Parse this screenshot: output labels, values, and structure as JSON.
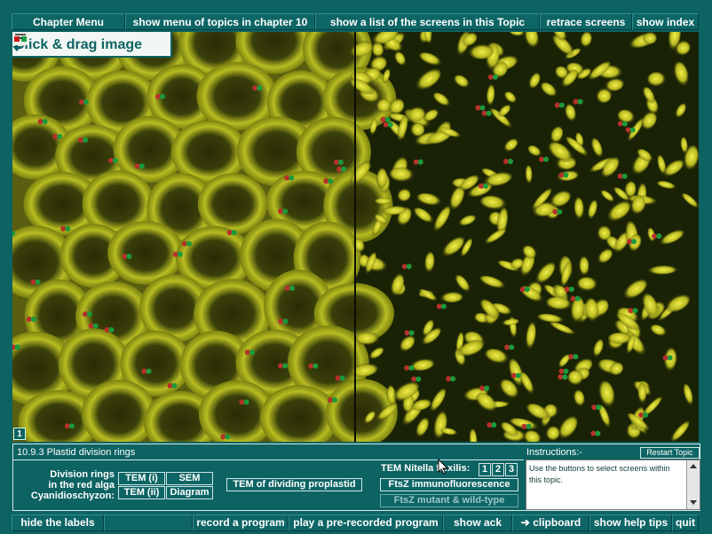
{
  "top_menu": {
    "chapter_menu": "Chapter Menu",
    "topics_menu": "show  menu of topics in  chapter  10",
    "screens_list": "show  a list of the screens in this Topic",
    "retrace": "retrace  screens",
    "index": "show  index"
  },
  "image": {
    "drag_hint": "Click & drag image",
    "frame_number": "1"
  },
  "panel": {
    "screen_title": "10.9.3  Plastid division rings",
    "division_label_lines": [
      "Division rings",
      "in the red alga",
      "Cyanidioschyzon:"
    ],
    "tem_i": "TEM   (i)",
    "sem": "SEM",
    "tem_ii": "TEM   (ii)",
    "diagram": "Diagram",
    "tem_dividing": "TEM of dividing proplastid",
    "nitella_label": "TEM Nitella flexilis:",
    "nitella_buttons": [
      "1",
      "2",
      "3"
    ],
    "ftsz_immuno": "FtsZ immunofluorescence",
    "ftsz_mutant": "FtsZ    mutant & wild-type",
    "instructions_label": "Instructions:-",
    "restart": "Restart Topic",
    "instructions_text": "Use the buttons to select screens within this topic."
  },
  "bottom_bar": {
    "hide_labels": "hide  the labels",
    "record": "record  a  program",
    "play": "play  a  pre-recorded  program",
    "ack": "show  ack",
    "clipboard": "clipboard",
    "help": "show help tips",
    "quit": "quit"
  },
  "colors": {
    "chrome_teal": "#0d6262",
    "cell_yellow": "#c9cc2a",
    "cell_dark": "#141b05",
    "label_teal": "#0d6262"
  }
}
